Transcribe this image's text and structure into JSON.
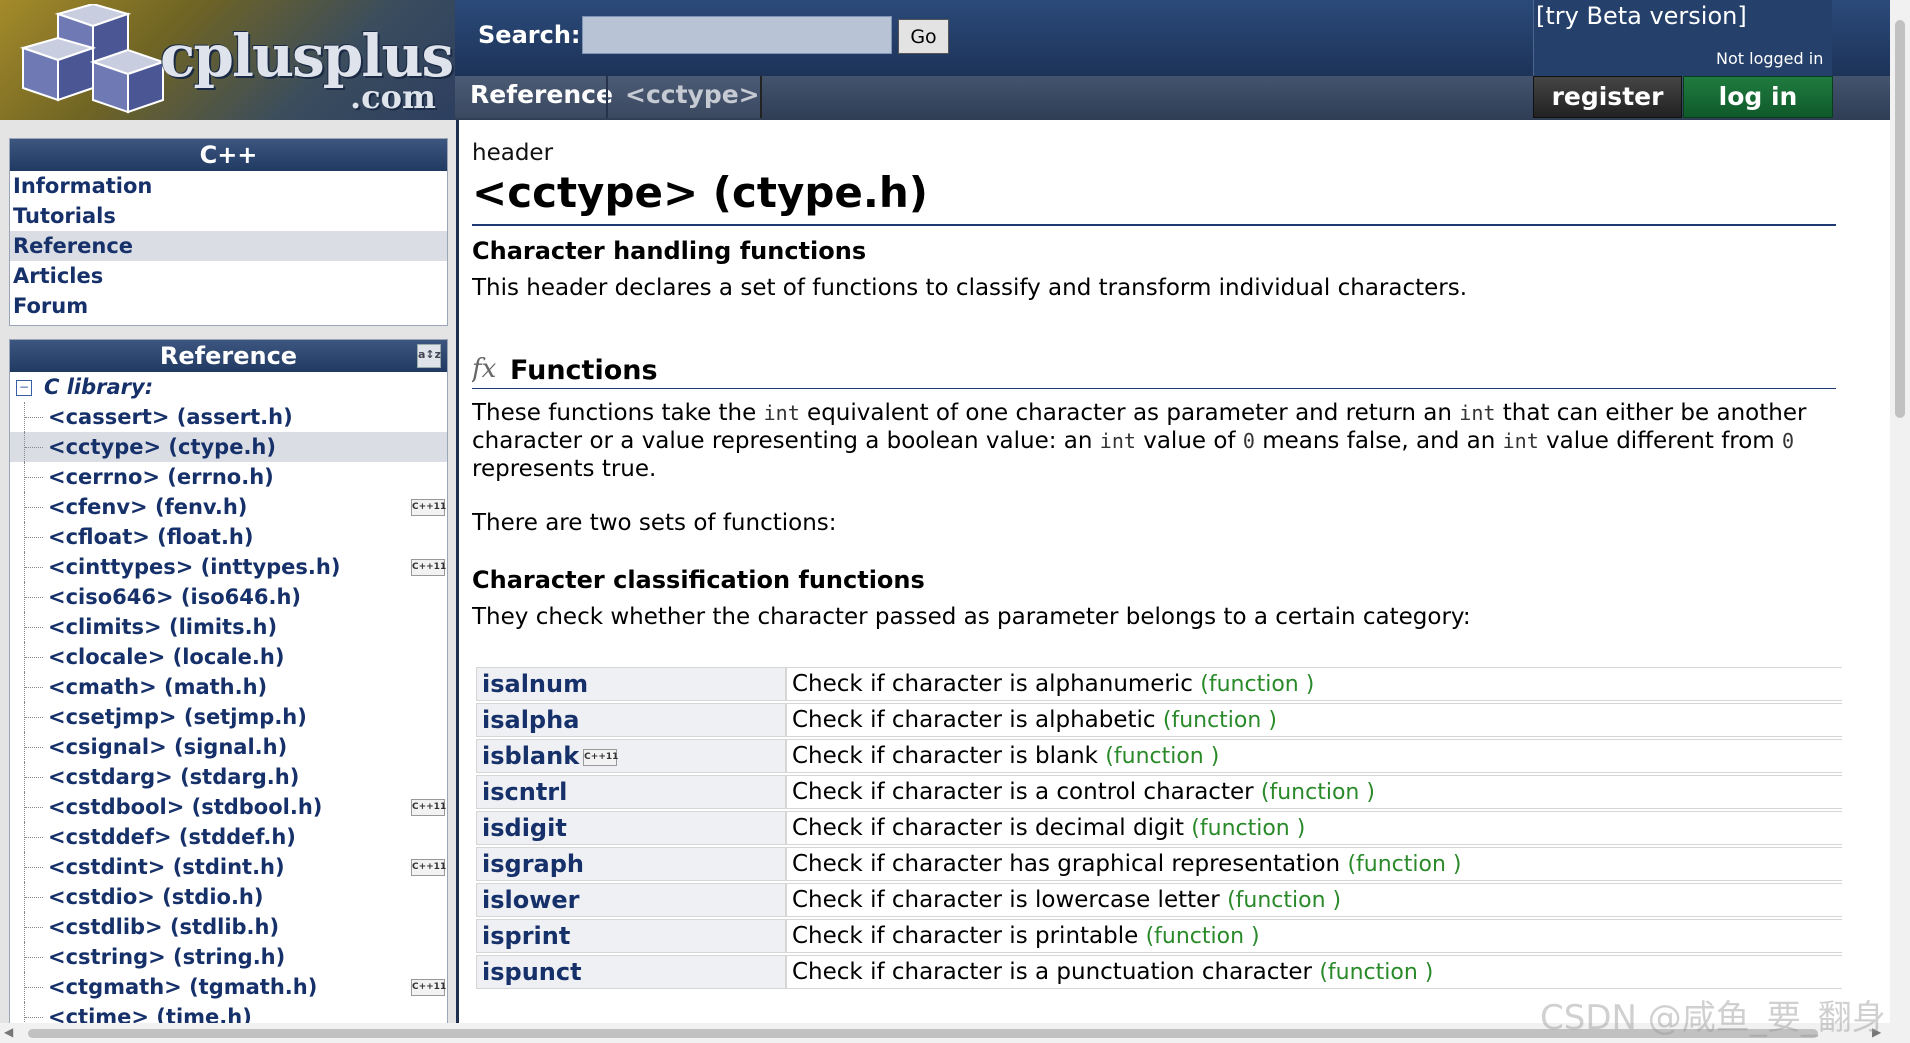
{
  "header": {
    "logo_text": "cplusplus",
    "logo_sub": ".com",
    "search_label": "Search:",
    "search_value": "",
    "go_label": "Go",
    "beta_link": "[try Beta version]",
    "login_status": "Not logged in",
    "register_label": "register",
    "login_label": "log in"
  },
  "breadcrumb": {
    "section": "Reference",
    "current": "<cctype>"
  },
  "sidebar": {
    "cpp_box_title": "C++",
    "nav_items": [
      {
        "label": "Information",
        "selected": false
      },
      {
        "label": "Tutorials",
        "selected": false
      },
      {
        "label": "Reference",
        "selected": true
      },
      {
        "label": "Articles",
        "selected": false
      },
      {
        "label": "Forum",
        "selected": false
      }
    ],
    "ref_box_title": "Reference",
    "clib_toggle": "−",
    "clib_label": "C library:",
    "cpp11_badge": "C++11",
    "libraries": [
      {
        "label": "<cassert> (assert.h)",
        "selected": false,
        "cpp11": false
      },
      {
        "label": "<cctype> (ctype.h)",
        "selected": true,
        "cpp11": false
      },
      {
        "label": "<cerrno> (errno.h)",
        "selected": false,
        "cpp11": false
      },
      {
        "label": "<cfenv> (fenv.h)",
        "selected": false,
        "cpp11": true
      },
      {
        "label": "<cfloat> (float.h)",
        "selected": false,
        "cpp11": false
      },
      {
        "label": "<cinttypes> (inttypes.h)",
        "selected": false,
        "cpp11": true
      },
      {
        "label": "<ciso646> (iso646.h)",
        "selected": false,
        "cpp11": false
      },
      {
        "label": "<climits> (limits.h)",
        "selected": false,
        "cpp11": false
      },
      {
        "label": "<clocale> (locale.h)",
        "selected": false,
        "cpp11": false
      },
      {
        "label": "<cmath> (math.h)",
        "selected": false,
        "cpp11": false
      },
      {
        "label": "<csetjmp> (setjmp.h)",
        "selected": false,
        "cpp11": false
      },
      {
        "label": "<csignal> (signal.h)",
        "selected": false,
        "cpp11": false
      },
      {
        "label": "<cstdarg> (stdarg.h)",
        "selected": false,
        "cpp11": false
      },
      {
        "label": "<cstdbool> (stdbool.h)",
        "selected": false,
        "cpp11": true
      },
      {
        "label": "<cstddef> (stddef.h)",
        "selected": false,
        "cpp11": false
      },
      {
        "label": "<cstdint> (stdint.h)",
        "selected": false,
        "cpp11": true
      },
      {
        "label": "<cstdio> (stdio.h)",
        "selected": false,
        "cpp11": false
      },
      {
        "label": "<cstdlib> (stdlib.h)",
        "selected": false,
        "cpp11": false
      },
      {
        "label": "<cstring> (string.h)",
        "selected": false,
        "cpp11": false
      },
      {
        "label": "<ctgmath> (tgmath.h)",
        "selected": false,
        "cpp11": true
      },
      {
        "label": "<ctime> (time.h)",
        "selected": false,
        "cpp11": false
      }
    ]
  },
  "main": {
    "kind": "header",
    "title": "<cctype> (ctype.h)",
    "subtitle": "Character handling functions",
    "description": "This header declares a set of functions to classify and transform individual characters.",
    "fx_glyph": "fx",
    "functions_heading": "Functions",
    "func_para": [
      {
        "t": "These functions take the "
      },
      {
        "t": "int",
        "code": true
      },
      {
        "t": " equivalent of one character as parameter and return an "
      },
      {
        "t": "int",
        "code": true
      },
      {
        "t": " that can either be another character or a value representing a boolean value: an "
      },
      {
        "t": "int",
        "code": true
      },
      {
        "t": " value of "
      },
      {
        "t": "0",
        "code": true
      },
      {
        "t": " means false, and an "
      },
      {
        "t": "int",
        "code": true
      },
      {
        "t": " value different from "
      },
      {
        "t": "0",
        "code": true
      },
      {
        "t": " represents true."
      }
    ],
    "two_sets": "There are two sets of functions:",
    "classification_heading": "Character classification functions",
    "classification_desc": "They check whether the character passed as parameter belongs to a certain category:",
    "function_kind": "(function )",
    "functions": [
      {
        "name": "isalnum",
        "desc": "Check if character is alphanumeric",
        "cpp11": false
      },
      {
        "name": "isalpha",
        "desc": "Check if character is alphabetic",
        "cpp11": false
      },
      {
        "name": "isblank",
        "desc": "Check if character is blank",
        "cpp11": true
      },
      {
        "name": "iscntrl",
        "desc": "Check if character is a control character",
        "cpp11": false
      },
      {
        "name": "isdigit",
        "desc": "Check if character is decimal digit",
        "cpp11": false
      },
      {
        "name": "isgraph",
        "desc": "Check if character has graphical representation",
        "cpp11": false
      },
      {
        "name": "islower",
        "desc": "Check if character is lowercase letter",
        "cpp11": false
      },
      {
        "name": "isprint",
        "desc": "Check if character is printable",
        "cpp11": false
      },
      {
        "name": "ispunct",
        "desc": "Check if character is a punctuation character",
        "cpp11": false
      }
    ]
  },
  "watermark": "CSDN @咸鱼_要_翻身",
  "colors": {
    "header_blue": "#1d3358",
    "link_navy": "#16306a",
    "login_green": "#1f7b3f",
    "function_green": "#2a8a2a"
  }
}
